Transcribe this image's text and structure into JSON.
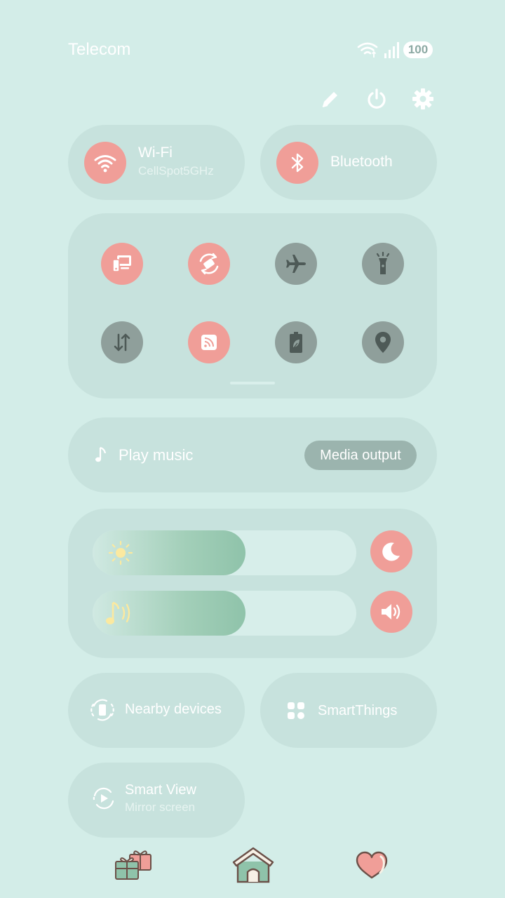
{
  "status_bar": {
    "carrier": "Telecom",
    "battery": "100",
    "icons": [
      "wifi-icon",
      "signal-icon",
      "battery-icon"
    ]
  },
  "header_actions": [
    "edit-icon",
    "power-icon",
    "settings-icon"
  ],
  "wifi_tile": {
    "title": "Wi-Fi",
    "subtitle": "CellSpot5GHz"
  },
  "bluetooth_tile": {
    "title": "Bluetooth"
  },
  "quick_toggles": [
    {
      "icon": "smart-view-icon",
      "active": true
    },
    {
      "icon": "auto-rotate-icon",
      "active": true
    },
    {
      "icon": "airplane-icon",
      "active": false
    },
    {
      "icon": "flashlight-icon",
      "active": false
    },
    {
      "icon": "mobile-data-icon",
      "active": false
    },
    {
      "icon": "nfc-icon",
      "active": true
    },
    {
      "icon": "power-saving-icon",
      "active": false
    },
    {
      "icon": "location-icon",
      "active": false
    }
  ],
  "media": {
    "label": "Play music",
    "output_button": "Media output"
  },
  "sliders": {
    "brightness": {
      "level": 0.58,
      "icon": "sun-icon",
      "side_icon": "moon-icon"
    },
    "volume": {
      "level": 0.58,
      "icon": "music-note-icon",
      "side_icon": "speaker-icon"
    }
  },
  "tiles": {
    "nearby": {
      "label": "Nearby devices"
    },
    "smartthings": {
      "label": "SmartThings"
    },
    "smartview": {
      "title": "Smart View",
      "subtitle": "Mirror screen"
    }
  },
  "dock": [
    "gift-icon",
    "home-icon",
    "heart-icon"
  ],
  "colors": {
    "background": "#d3ede8",
    "accent": "#f09e98",
    "inactive": "#8f9f9b",
    "panel": "#c7e2dd"
  }
}
